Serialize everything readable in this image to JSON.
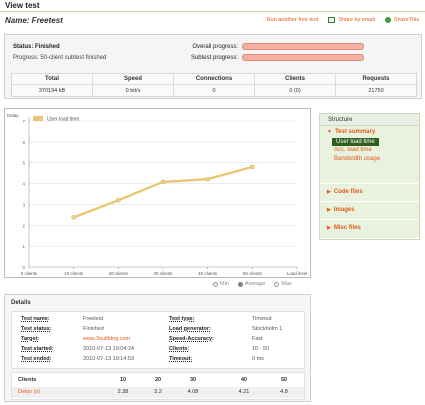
{
  "page": {
    "title": "View test"
  },
  "test": {
    "name_line": "Name: Freetest"
  },
  "actions": {
    "run_another": "Run another free test",
    "share_email": "Share by email",
    "share_this": "ShareThis"
  },
  "status": {
    "status_line": "Status: Finished",
    "progress_line": "Progress: 50-client subtest finished",
    "overall_label": "Overall progress:",
    "subtest_label": "Subtest progress:",
    "overall_progress": 1.0,
    "subtest_progress": 1.0
  },
  "stats": [
    {
      "label": "Total",
      "value": "370194 kB"
    },
    {
      "label": "Speed",
      "value": "0 bit/s"
    },
    {
      "label": "Connections",
      "value": "0"
    },
    {
      "label": "Clients",
      "value": "0 (0)"
    },
    {
      "label": "Requests",
      "value": "21750"
    }
  ],
  "chart_data": {
    "type": "line",
    "ylabel": "Delay",
    "x": [
      "0 clients",
      "10 clients",
      "20 clients",
      "30 clients",
      "40 clients",
      "50 clients",
      "Load level"
    ],
    "series": [
      {
        "name": "User load time",
        "x": [
          10,
          20,
          30,
          40,
          50
        ],
        "values": [
          2.38,
          3.2,
          4.08,
          4.21,
          4.8
        ],
        "color": "#e8c878"
      }
    ],
    "y_ticks": [
      "0",
      "1",
      "2",
      "3",
      "4",
      "5",
      "6",
      "7"
    ],
    "ylim": [
      0,
      7
    ],
    "xlim": [
      0,
      60
    ],
    "grid": true,
    "legend": "top-left"
  },
  "chart_options": {
    "min": "Min",
    "average": "Average",
    "max": "Max",
    "selected": "Average"
  },
  "structure": {
    "title": "Structure",
    "sections": [
      {
        "title": "Test summary",
        "expanded": true,
        "items": [
          "User load time",
          "Acc. load time",
          "Bandwidth usage"
        ],
        "active": "User load time"
      },
      {
        "title": "Code files",
        "expanded": false,
        "items": []
      },
      {
        "title": "Images",
        "expanded": false,
        "items": []
      },
      {
        "title": "Misc files",
        "expanded": false,
        "items": []
      }
    ]
  },
  "details": {
    "title": "Details",
    "left": [
      {
        "label": "Test name:",
        "value": "Freetest"
      },
      {
        "label": "Test status:",
        "value": "Finished"
      },
      {
        "label": "Target:",
        "value": "www.3sultblog.com"
      },
      {
        "label": "Test started:",
        "value": "2010-07-13 19:04:24"
      },
      {
        "label": "Test ended:",
        "value": "2010-07-13 19:14:53"
      }
    ],
    "right": [
      {
        "label": "Test type:",
        "value": "Timeout"
      },
      {
        "label": "Load generator:",
        "value": "Stockholm 1"
      },
      {
        "label": "Speed-Accuracy:",
        "value": "Fast"
      },
      {
        "label": "Clients:",
        "value": "10 - 50"
      },
      {
        "label": "Timeout:",
        "value": "0 ms"
      }
    ],
    "metrics": {
      "header_label": "Clients",
      "row_label": "Delay (s)",
      "columns": [
        "10",
        "20",
        "30",
        "40",
        "50"
      ],
      "values": [
        "2.38",
        "3.2",
        "4.08",
        "4.21",
        "4.8"
      ]
    }
  }
}
